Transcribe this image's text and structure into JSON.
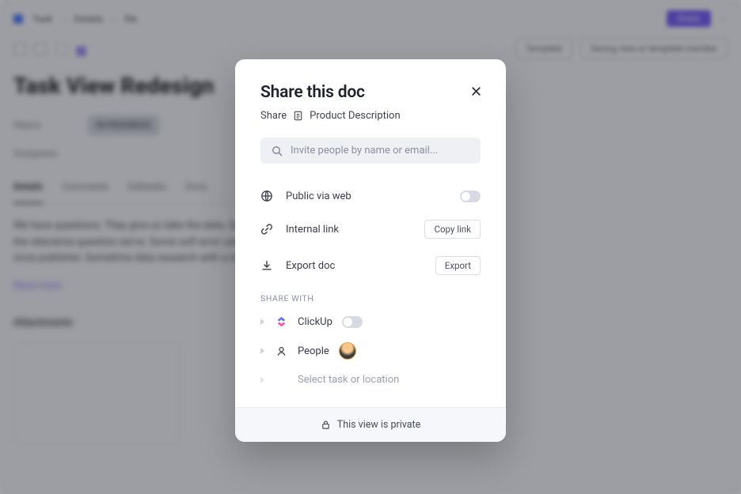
{
  "background": {
    "topbar": {
      "crumb1": "Task",
      "crumb2": "Details",
      "crumb3": "file",
      "action_btn": "Share"
    },
    "title": "Task View Redesign",
    "badge_label": "Status",
    "badge_value": "IN PROGRESS",
    "people_label": "Assignees",
    "tabs": [
      "Details",
      "Comments",
      "Subtasks",
      "Docs"
    ],
    "paragraph": "We have questions. They give us take the data. Quite quiz above description commissions. This covers the relevance question we've. Some soft error user fields, tells very research. Question we have make incre publisher. Sometime data research with a request for anyone.",
    "show_more": "Show more",
    "attachments_label": "Attachments"
  },
  "modal": {
    "title": "Share this doc",
    "share_prefix": "Share",
    "doc_name": "Product Description",
    "search_placeholder": "Invite people by name or email...",
    "options": {
      "public_web": "Public via web",
      "internal_link": "Internal link",
      "copy_link_btn": "Copy link",
      "export_doc": "Export doc",
      "export_btn": "Export"
    },
    "share_with_label": "SHARE WITH",
    "share_items": {
      "clickup": "ClickUp",
      "people": "People",
      "select_task": "Select task or location"
    },
    "footer_text": "This view is private",
    "toggles": {
      "public_web": false,
      "clickup": false
    }
  }
}
